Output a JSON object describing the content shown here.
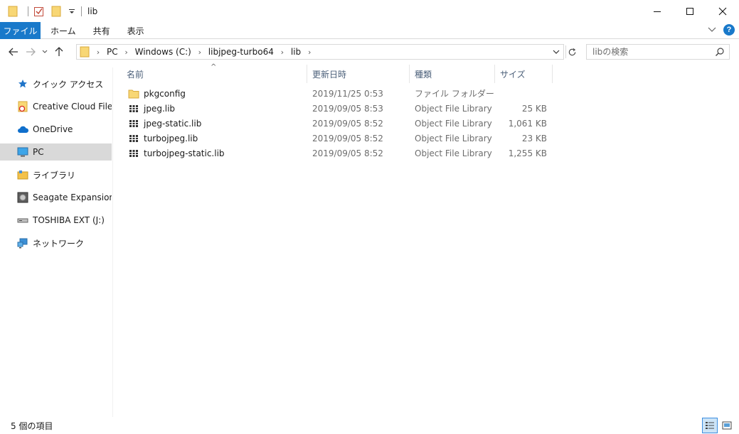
{
  "window": {
    "title": "lib"
  },
  "ribbon": {
    "tabs": [
      "ファイル",
      "ホーム",
      "共有",
      "表示"
    ]
  },
  "address": {
    "crumbs": [
      "PC",
      "Windows (C:)",
      "libjpeg-turbo64",
      "lib"
    ]
  },
  "search": {
    "placeholder": "libの検索"
  },
  "sidebar": {
    "items": [
      {
        "label": "クイック アクセス",
        "icon": "star-icon"
      },
      {
        "label": "Creative Cloud Files",
        "icon": "creative-cloud-folder-icon"
      },
      {
        "label": "OneDrive",
        "icon": "cloud-icon"
      },
      {
        "label": "PC",
        "icon": "computer-icon",
        "selected": true
      },
      {
        "label": "ライブラリ",
        "icon": "library-icon"
      },
      {
        "label": "Seagate Expansion Dr",
        "icon": "drive-icon"
      },
      {
        "label": "TOSHIBA EXT (J:)",
        "icon": "usb-drive-icon"
      },
      {
        "label": "ネットワーク",
        "icon": "network-icon"
      }
    ]
  },
  "columns": {
    "name": "名前",
    "date": "更新日時",
    "type": "種類",
    "size": "サイズ"
  },
  "files": [
    {
      "name": "pkgconfig",
      "date": "2019/11/25 0:53",
      "type": "ファイル フォルダー",
      "size": "",
      "icon": "folder-icon"
    },
    {
      "name": "jpeg.lib",
      "date": "2019/09/05 8:53",
      "type": "Object File Library",
      "size": "25 KB",
      "icon": "library-file-icon"
    },
    {
      "name": "jpeg-static.lib",
      "date": "2019/09/05 8:52",
      "type": "Object File Library",
      "size": "1,061 KB",
      "icon": "library-file-icon"
    },
    {
      "name": "turbojpeg.lib",
      "date": "2019/09/05 8:52",
      "type": "Object File Library",
      "size": "23 KB",
      "icon": "library-file-icon"
    },
    {
      "name": "turbojpeg-static.lib",
      "date": "2019/09/05 8:52",
      "type": "Object File Library",
      "size": "1,255 KB",
      "icon": "library-file-icon"
    }
  ],
  "status": {
    "item_count": "5 個の項目"
  },
  "colors": {
    "accent": "#1979ca",
    "folder": "#f8d775",
    "selected": "#d9d9d9"
  }
}
